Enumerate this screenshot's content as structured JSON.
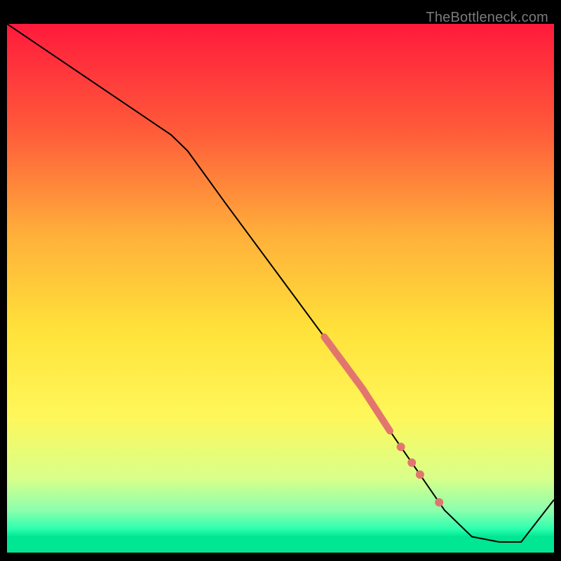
{
  "watermark": "TheBottleneck.com",
  "chart_data": {
    "type": "line",
    "title": "",
    "xlabel": "",
    "ylabel": "",
    "xlim": [
      0,
      100
    ],
    "ylim": [
      0,
      100
    ],
    "grid": false,
    "legend": false,
    "background_gradient": {
      "stops": [
        {
          "offset": 0.0,
          "color": "#ff1a3c"
        },
        {
          "offset": 0.2,
          "color": "#ff5a3a"
        },
        {
          "offset": 0.4,
          "color": "#ffb03a"
        },
        {
          "offset": 0.58,
          "color": "#ffe23a"
        },
        {
          "offset": 0.74,
          "color": "#fff75a"
        },
        {
          "offset": 0.86,
          "color": "#d8ff8a"
        },
        {
          "offset": 0.92,
          "color": "#8cffad"
        },
        {
          "offset": 0.955,
          "color": "#2dffae"
        },
        {
          "offset": 0.97,
          "color": "#00e693"
        },
        {
          "offset": 1.0,
          "color": "#00e693"
        }
      ]
    },
    "series": [
      {
        "name": "bottleneck-curve",
        "color": "#000000",
        "width": 2,
        "x": [
          0,
          10,
          20,
          30,
          33,
          40,
          50,
          60,
          65,
          70,
          74,
          78,
          80,
          85,
          90,
          94,
          100
        ],
        "y": [
          100,
          93,
          86,
          79,
          76,
          66,
          52,
          38,
          31,
          23,
          17,
          11,
          8,
          3,
          2,
          2,
          10
        ]
      }
    ],
    "highlight_segment": {
      "on_series": "bottleneck-curve",
      "color": "#e2766f",
      "width": 10,
      "x_start": 58,
      "x_end": 70
    },
    "highlight_points": {
      "on_series": "bottleneck-curve",
      "color": "#e2766f",
      "radius": 6,
      "x": [
        72,
        74,
        75.5,
        79
      ]
    }
  }
}
